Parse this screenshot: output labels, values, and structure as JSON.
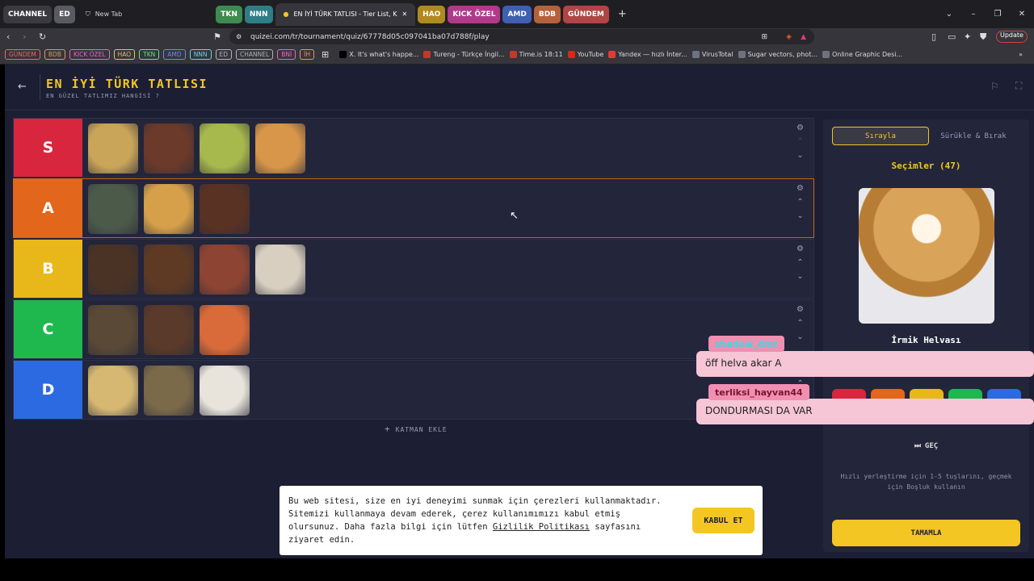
{
  "browser": {
    "group_tabs_left": [
      {
        "label": "CHANNEL",
        "color": "#3a3a40"
      },
      {
        "label": "ED",
        "color": "#5a5a62"
      }
    ],
    "new_tab_label": "New Tab",
    "active_tab_label": "EN İYİ TÜRK TATLISI - Tier List, K",
    "group_tabs_mid": [
      {
        "label": "TKN",
        "color": "#3e8b4f"
      },
      {
        "label": "NNN",
        "color": "#2f7d86"
      }
    ],
    "group_tabs_right": [
      {
        "label": "HAO",
        "color": "#b08a1e"
      },
      {
        "label": "KICK ÖZEL",
        "color": "#b03a8a"
      },
      {
        "label": "AMD",
        "color": "#3f5fb0"
      },
      {
        "label": "BDB",
        "color": "#b5623a"
      },
      {
        "label": "GÜNDEM",
        "color": "#b04545"
      }
    ],
    "url": "quizei.com/tr/tournament/quiz/67778d05c097041ba07d788f/play",
    "update_label": "Update",
    "bookmark_groups": [
      {
        "label": "GÜNDEM",
        "color": "#e06b6b"
      },
      {
        "label": "BDB",
        "color": "#e0946b"
      },
      {
        "label": "KICK ÖZEL",
        "color": "#e06bbf"
      },
      {
        "label": "HAO",
        "color": "#e0c16b"
      },
      {
        "label": "TKN",
        "color": "#6be08a"
      },
      {
        "label": "AMD",
        "color": "#6b8ee0"
      },
      {
        "label": "NNN",
        "color": "#6bd5e0"
      },
      {
        "label": "ED",
        "color": "#b0b0b8"
      },
      {
        "label": "CHANNEL",
        "color": "#b0b0b8"
      },
      {
        "label": "BNİ",
        "color": "#e06bbf"
      },
      {
        "label": "İH",
        "color": "#e0946b"
      }
    ],
    "bookmarks": [
      {
        "label": "X. It's what's happe...",
        "color": "#000000"
      },
      {
        "label": "Tureng - Türkçe İngil...",
        "color": "#c0392b"
      },
      {
        "label": "Time.is 18:11",
        "color": "#c0392b"
      },
      {
        "label": "YouTube",
        "color": "#e62117"
      },
      {
        "label": "Yandex — hızlı İnter...",
        "color": "#e53935"
      },
      {
        "label": "VirusTotal",
        "color": "#6b7280"
      },
      {
        "label": "Sugar vectors, phot...",
        "color": "#6b7280"
      },
      {
        "label": "Online Graphic Desi...",
        "color": "#6b7280"
      }
    ]
  },
  "page": {
    "title": "EN İYİ TÜRK TATLISI",
    "subtitle": "EN GÜZEL TATLIMIZ HANGİSİ ?",
    "tiers": [
      {
        "label": "S",
        "color": "#d7263d",
        "items": [
          "#c9a55a",
          "#6b3a2a",
          "#a7b84d",
          "#d8964a"
        ]
      },
      {
        "label": "A",
        "color": "#e2661b",
        "items": [
          "#4c5a4a",
          "#d6a04a",
          "#5a3224"
        ]
      },
      {
        "label": "B",
        "color": "#e8b81a",
        "items": [
          "#4a3324",
          "#5e3a24",
          "#8e4433",
          "#d9cfc0"
        ]
      },
      {
        "label": "C",
        "color": "#1fb84f",
        "items": [
          "#5a4936",
          "#5a3a2a",
          "#d96b3a"
        ]
      },
      {
        "label": "D",
        "color": "#2b6ae0",
        "items": [
          "#d6b873",
          "#7b6a4a",
          "#e8e4dc"
        ]
      }
    ],
    "add_layer_label": "KATMAN EKLE"
  },
  "sidebar": {
    "mode_sequential": "Sırayla",
    "mode_drag": "Sürükle & Bırak",
    "selections_label": "Seçimler (47)",
    "current_item_name": "İrmik Helvası",
    "skip_label": "GEÇ",
    "hint": "Hızlı yerleştirme için 1-5 tuşlarını, geçmek için Boşluk kullanın",
    "finish_label": "TAMAMLA"
  },
  "chat": [
    {
      "user": "shadow_dmr",
      "message": "öff helva akar A",
      "user_color": "#37d9e8"
    },
    {
      "user": "terliksi_hayvan44",
      "message": "DONDURMASI DA VAR",
      "user_color": "#7a1530"
    }
  ],
  "cookie": {
    "text_before_link": "Bu web sitesi, size en iyi deneyimi sunmak için çerezleri kullanmaktadır. Sitemizi kullanmaya devam ederek, çerez kullanımımızı kabul etmiş olursunuz. Daha fazla bilgi için lütfen ",
    "link_text": "Gizlilik Politikası",
    "text_after_link": " sayfasını ziyaret edin.",
    "accept_label": "KABUL ET"
  }
}
